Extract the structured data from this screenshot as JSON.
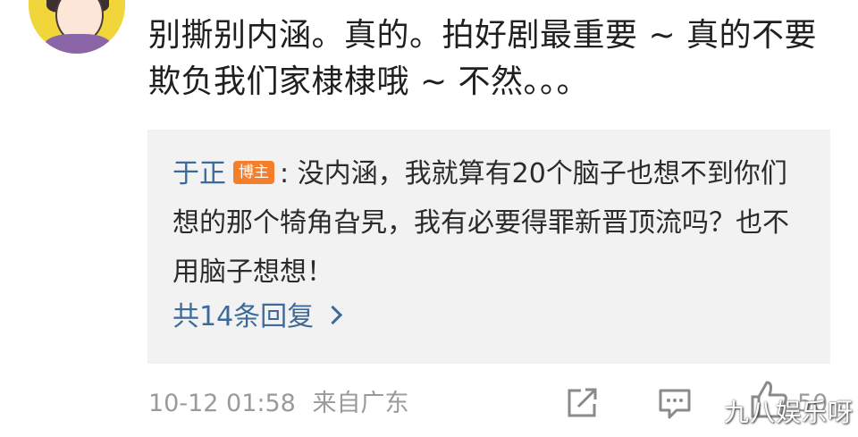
{
  "post": {
    "text": "别撕别内涵。真的。拍好剧最重要 ~ 真的不要欺负我们家棣棣哦 ~ 不然。。。"
  },
  "reply": {
    "author": "于正",
    "badge": "博主",
    "separator": ":",
    "text": "没内涵，我就算有20个脑子也想不到你们想的那个犄角旮旯，我有必要得罪新晋顶流吗？也不用脑子想想！",
    "more_label": "共14条回复"
  },
  "meta": {
    "datetime": "10-12 01:58",
    "source": "来自广东"
  },
  "actions": {
    "like_count": "50"
  },
  "watermark": "九八娱乐呀",
  "colors": {
    "link": "#3d6a9a",
    "badge": "#f57e2a",
    "reply_bg": "#f2f2f2",
    "meta": "#9a9a9a"
  },
  "icons": [
    "share-icon",
    "comment-icon",
    "like-icon",
    "chevron-right-icon"
  ]
}
